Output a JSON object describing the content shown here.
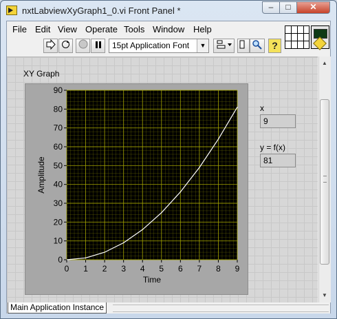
{
  "window": {
    "title": "nxtLabviewXyGraph1_0.vi Front Panel *",
    "buttons": {
      "minimize": "–",
      "maximize": "□",
      "close": "✕"
    }
  },
  "menu": [
    "File",
    "Edit",
    "View",
    "Operate",
    "Tools",
    "Window",
    "Help"
  ],
  "toolbar": {
    "run_icon": "run-arrow-icon",
    "font_select": "15pt Application Font"
  },
  "panel": {
    "graph_label": "XY Graph",
    "x_label": "x",
    "x_value": "9",
    "y_label": "y = f(x)",
    "y_value": "81"
  },
  "status": {
    "context": "Main Application Instance"
  },
  "colors": {
    "plot_bg": "#000000",
    "grid": "#a5a500",
    "trace": "#ffffff",
    "frame": "#a7a7a7"
  },
  "chart_data": {
    "type": "line",
    "xlabel": "Time",
    "ylabel": "Amplitude",
    "xlim": [
      0,
      9
    ],
    "ylim": [
      0,
      90
    ],
    "x_ticks": [
      0,
      1,
      2,
      3,
      4,
      5,
      6,
      7,
      8,
      9
    ],
    "y_ticks": [
      0,
      10,
      20,
      30,
      40,
      50,
      60,
      70,
      80,
      90
    ],
    "grid": true,
    "series": [
      {
        "x": [
          0,
          1,
          2,
          3,
          4,
          5,
          6,
          7,
          8,
          9
        ],
        "values": [
          0,
          1,
          4,
          9,
          16,
          25,
          36,
          49,
          64,
          81
        ]
      }
    ]
  }
}
